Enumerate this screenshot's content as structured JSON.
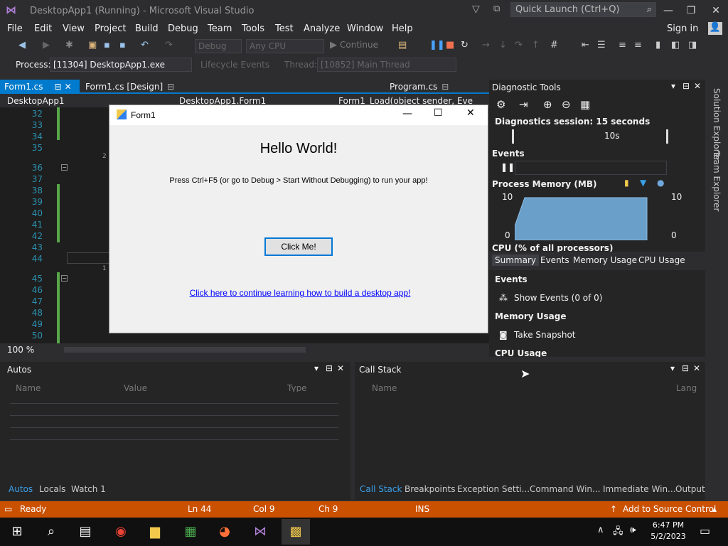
{
  "title": "DesktopApp1 (Running) - Microsoft Visual Studio",
  "quick_launch": "Quick Launch (Ctrl+Q)",
  "menu": [
    "File",
    "Edit",
    "View",
    "Project",
    "Build",
    "Debug",
    "Team",
    "Tools",
    "Test",
    "Analyze",
    "Window",
    "Help"
  ],
  "signin": "Sign in",
  "toolbar": {
    "config": "Debug",
    "platform": "Any CPU",
    "continue": "Continue"
  },
  "process": {
    "label": "Process:",
    "value": "[11304] DesktopApp1.exe",
    "lifecycle": "Lifecycle Events",
    "thread_label": "Thread:",
    "thread": "[10852] Main Thread"
  },
  "doc_tabs": {
    "active": "Form1.cs",
    "design": "Form1.cs [Design]",
    "program": "Program.cs"
  },
  "nav": {
    "project": "DesktopApp1",
    "class": "DesktopApp1.Form1",
    "member": "Form1_Load(object sender, EventAr"
  },
  "lines": [
    "32",
    "33",
    "34",
    "35",
    "36",
    "37",
    "38",
    "39",
    "40",
    "41",
    "42",
    "43",
    "44",
    "45",
    "46",
    "47",
    "48",
    "49",
    "50"
  ],
  "code_refs": [
    "2 r",
    "1 r"
  ],
  "zoom": "100 %",
  "form1": {
    "title": "Form1",
    "hello": "Hello World!",
    "press": "Press Ctrl+F5 (or go to Debug > Start Without Debugging) to run your app!",
    "button": "Click Me!",
    "link": "Click here to continue learning how to build a desktop app!"
  },
  "diag": {
    "title": "Diagnostic Tools",
    "session": "Diagnostics session: 15 seconds",
    "tick": "10s",
    "events": "Events",
    "memory": "Process Memory (MB)",
    "mem_max": "10",
    "mem_min": "0",
    "cpu": "CPU (% of all processors)",
    "tabs": [
      "Summary",
      "Events",
      "Memory Usage",
      "CPU Usage"
    ],
    "sum_events": "Events",
    "show_events": "Show Events (0 of 0)",
    "sum_memory": "Memory Usage",
    "snapshot": "Take Snapshot",
    "sum_cpu": "CPU Usage"
  },
  "side": [
    "Solution Explorer",
    "Team Explorer"
  ],
  "autos": {
    "title": "Autos",
    "cols": [
      "Name",
      "Value",
      "Type"
    ],
    "tabs": [
      "Autos",
      "Locals",
      "Watch 1"
    ]
  },
  "callstack": {
    "title": "Call Stack",
    "cols": [
      "Name",
      "Lang"
    ],
    "tabs": [
      "Call Stack",
      "Breakpoints",
      "Exception Setti...",
      "Command Win...",
      "Immediate Win...",
      "Output"
    ]
  },
  "status": {
    "ready": "Ready",
    "ln": "Ln 44",
    "col": "Col 9",
    "ch": "Ch 9",
    "ins": "INS",
    "source": "Add to Source Control"
  },
  "clock": {
    "time": "6:47 PM",
    "date": "5/2/2023"
  },
  "colors": {
    "accent": "#007acc",
    "status": "#ca5100",
    "editor": "#1e1e1e"
  }
}
